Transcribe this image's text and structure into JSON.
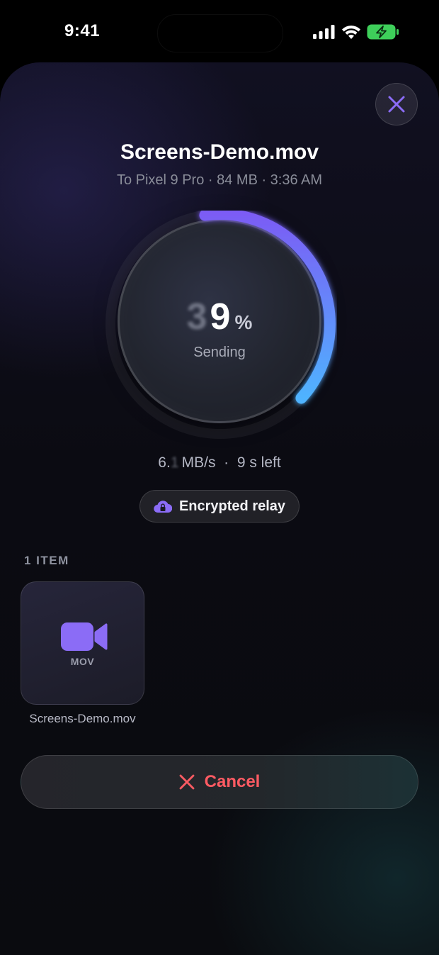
{
  "status_bar": {
    "time": "9:41"
  },
  "transfer": {
    "file_title": "Screens-Demo.mov",
    "meta": "To Pixel 9 Pro · 84 MB · 3:36 AM",
    "progress_percent": 39,
    "digit_ghost": "3",
    "digit_main": "9",
    "percent_sign": "%",
    "status_label": "Sending",
    "speed_prefix": "6.",
    "speed_ghost": "1",
    "speed_suffix": " MB/s  ·  9 s left"
  },
  "relay": {
    "label": "Encrypted relay",
    "icon": "cloud-lock-icon"
  },
  "items": {
    "header": "1 ITEM",
    "files": [
      {
        "type_label": "MOV",
        "name": "Screens-Demo.mov",
        "icon": "video-camera-icon"
      }
    ]
  },
  "actions": {
    "cancel_label": "Cancel"
  },
  "colors": {
    "accent_purple": "#8b6cf6",
    "ring_start": "#7b5cf5",
    "ring_end": "#4fb3ff",
    "cancel_red": "#ff5b63",
    "battery_green": "#3ecf5a"
  }
}
